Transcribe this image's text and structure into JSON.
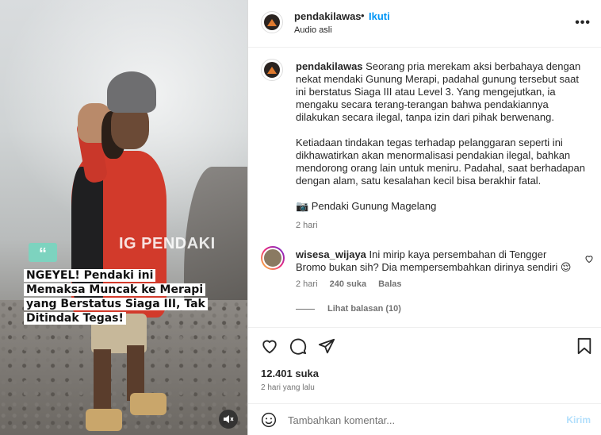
{
  "post": {
    "author": "pendakilawas",
    "follow_label": "Ikuti",
    "dot": "•",
    "audio": "Audio asli"
  },
  "media": {
    "watermark": "IG PENDAKI",
    "quote_mark": "“",
    "headline_lines": [
      "NGEYEL! Pendaki ini",
      "Memaksa Muncak ke Merapi",
      "yang Berstatus Siaga III, Tak",
      "Ditindak Tegas!"
    ]
  },
  "caption": {
    "username": "pendakilawas",
    "paragraph1": "Seorang pria merekam aksi berbahaya dengan nekat mendaki Gunung Merapi, padahal gunung tersebut saat ini berstatus Siaga III atau Level 3. Yang mengejutkan, ia mengaku secara terang-terangan bahwa pendakiannya dilakukan secara ilegal, tanpa izin dari pihak berwenang.",
    "paragraph2": "Ketiadaan tindakan tegas terhadap pelanggaran seperti ini dikhawatirkan akan menormalisasi pendakian ilegal, bahkan mendorong orang lain untuk meniru. Padahal, saat berhadapan dengan alam, satu kesalahan kecil bisa berakhir fatal.",
    "credit": "📷 Pendaki Gunung Magelang",
    "age": "2 hari"
  },
  "comment": {
    "username": "wisesa_wijaya",
    "text": "Ini mirip kaya persembahan di Tengger Bromo bukan sih? Dia mempersembahkan dirinya sendiri 😌",
    "age": "2 hari",
    "likes": "240 suka",
    "reply_label": "Balas",
    "view_replies": "Lihat balasan (10)"
  },
  "stats": {
    "likes": "12.401 suka",
    "posted": "2 hari yang lalu"
  },
  "composer": {
    "placeholder": "Tambahkan komentar...",
    "send_label": "Kirim"
  },
  "colors": {
    "link": "#0095f6",
    "send_disabled": "#b2dffc",
    "secondary_text": "#737373",
    "quote_badge": "#7dd3bf"
  }
}
